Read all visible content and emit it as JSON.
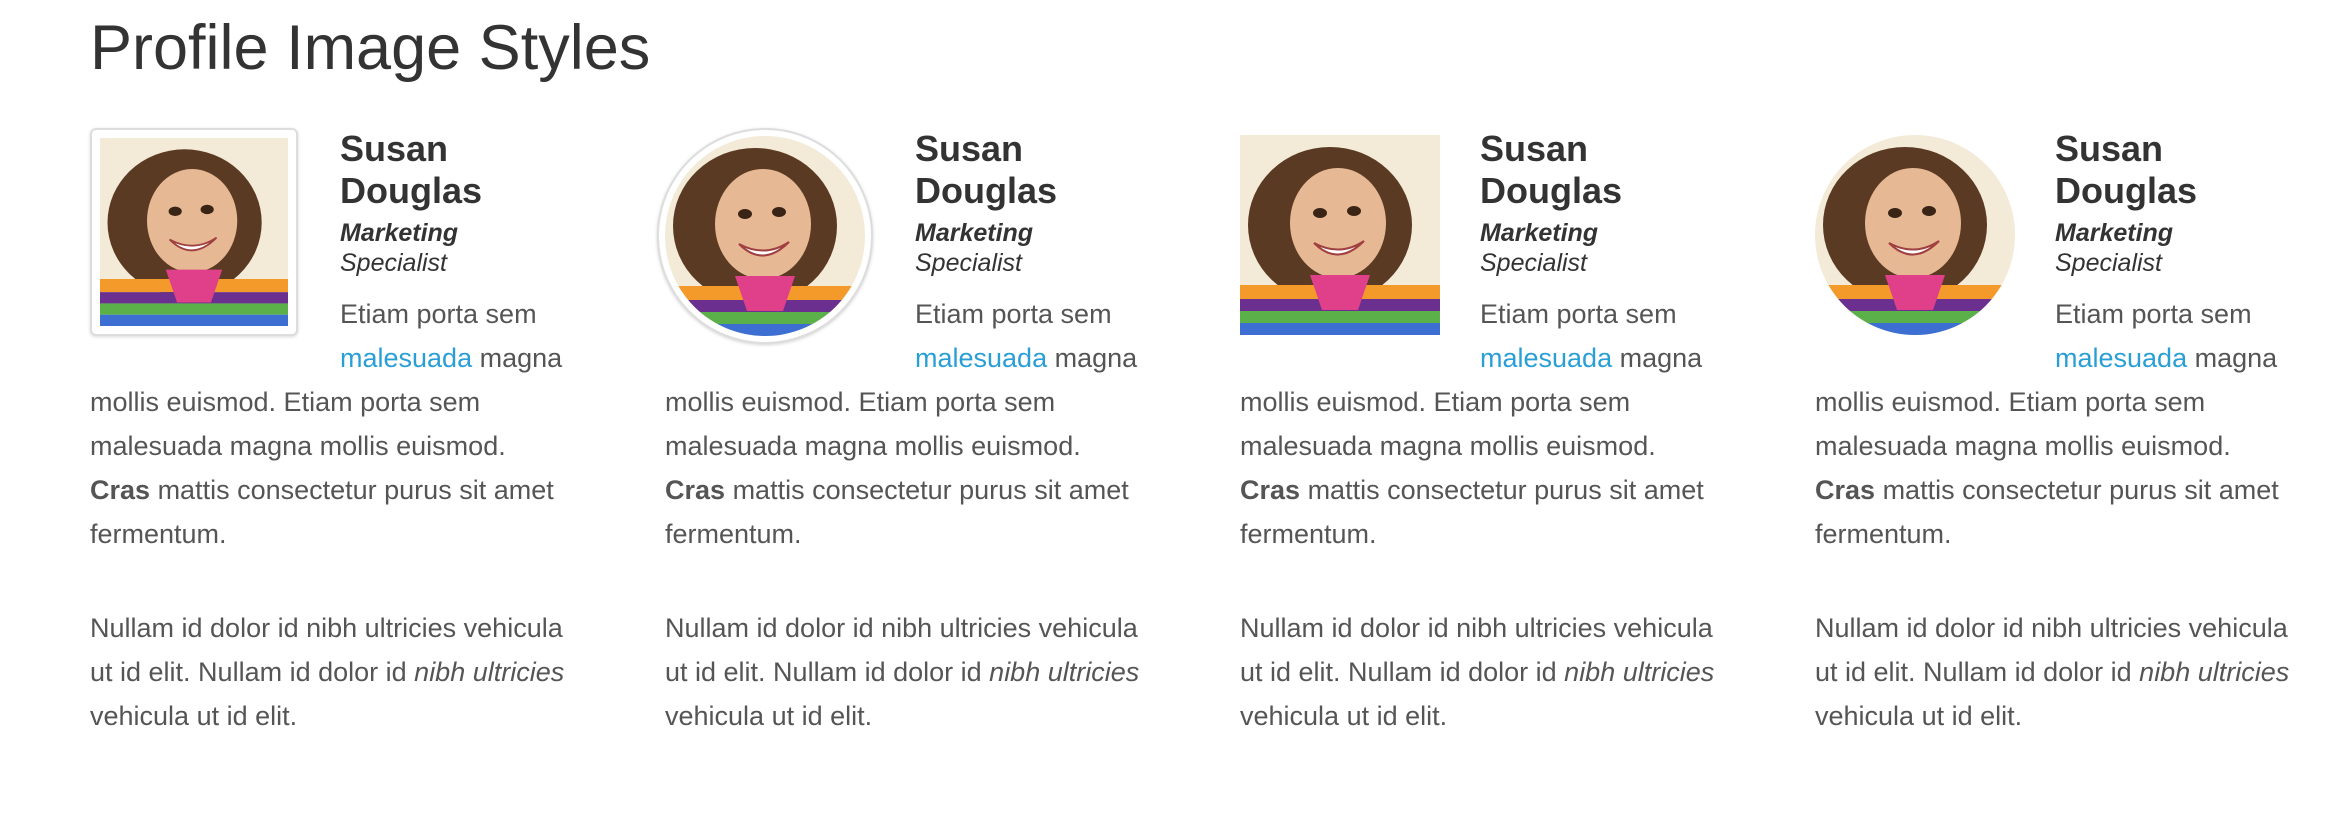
{
  "page": {
    "title": "Profile Image Styles"
  },
  "cards": [
    {
      "style": "thumbnail",
      "image_name": "profile-photo",
      "first_name": "Susan",
      "last_name": "Douglas",
      "role_title": "Marketing",
      "role_sub": "Specialist",
      "bio": {
        "lead": "Etiam porta sem",
        "link": "malesuada",
        "text1": "magna mollis euismod. Etiam porta sem malesuada magna mollis euismod.",
        "bold": "Cras",
        "text2": "mattis consectetur purus sit amet fermentum."
      },
      "bio2": {
        "text1": "Nullam id dolor id nibh ultricies vehicula ut id elit. Nullam id dolor id",
        "italic": "nibh ultricies",
        "text2": "vehicula ut id elit."
      }
    },
    {
      "style": "circle-bordered",
      "image_name": "profile-photo",
      "first_name": "Susan",
      "last_name": "Douglas",
      "role_title": "Marketing",
      "role_sub": "Specialist",
      "bio": {
        "lead": "Etiam porta sem",
        "link": "malesuada",
        "text1": "magna mollis euismod. Etiam porta sem malesuada magna mollis euismod.",
        "bold": "Cras",
        "text2": "mattis consectetur purus sit amet fermentum."
      },
      "bio2": {
        "text1": "Nullam id dolor id nibh ultricies vehicula ut id elit. Nullam id dolor id",
        "italic": "nibh ultricies",
        "text2": "vehicula ut id elit."
      }
    },
    {
      "style": "plain",
      "image_name": "profile-photo",
      "first_name": "Susan",
      "last_name": "Douglas",
      "role_title": "Marketing",
      "role_sub": "Specialist",
      "bio": {
        "lead": "Etiam porta sem",
        "link": "malesuada",
        "text1": "magna mollis euismod. Etiam porta sem malesuada magna mollis euismod.",
        "bold": "Cras",
        "text2": "mattis consectetur purus sit amet fermentum."
      },
      "bio2": {
        "text1": "Nullam id dolor id nibh ultricies vehicula ut id elit. Nullam id dolor id",
        "italic": "nibh ultricies",
        "text2": "vehicula ut id elit."
      }
    },
    {
      "style": "circle",
      "image_name": "profile-photo",
      "first_name": "Susan",
      "last_name": "Douglas",
      "role_title": "Marketing",
      "role_sub": "Specialist",
      "bio": {
        "lead": "Etiam porta sem",
        "link": "malesuada",
        "text1": "magna mollis euismod. Etiam porta sem malesuada magna mollis euismod.",
        "bold": "Cras",
        "text2": "mattis consectetur purus sit amet fermentum."
      },
      "bio2": {
        "text1": "Nullam id dolor id nibh ultricies vehicula ut id elit. Nullam id dolor id",
        "italic": "nibh ultricies",
        "text2": "vehicula ut id elit."
      }
    }
  ],
  "colors": {
    "link": "#2a9fd6",
    "heading": "#333333",
    "body": "#555555",
    "border": "#dddddd"
  }
}
